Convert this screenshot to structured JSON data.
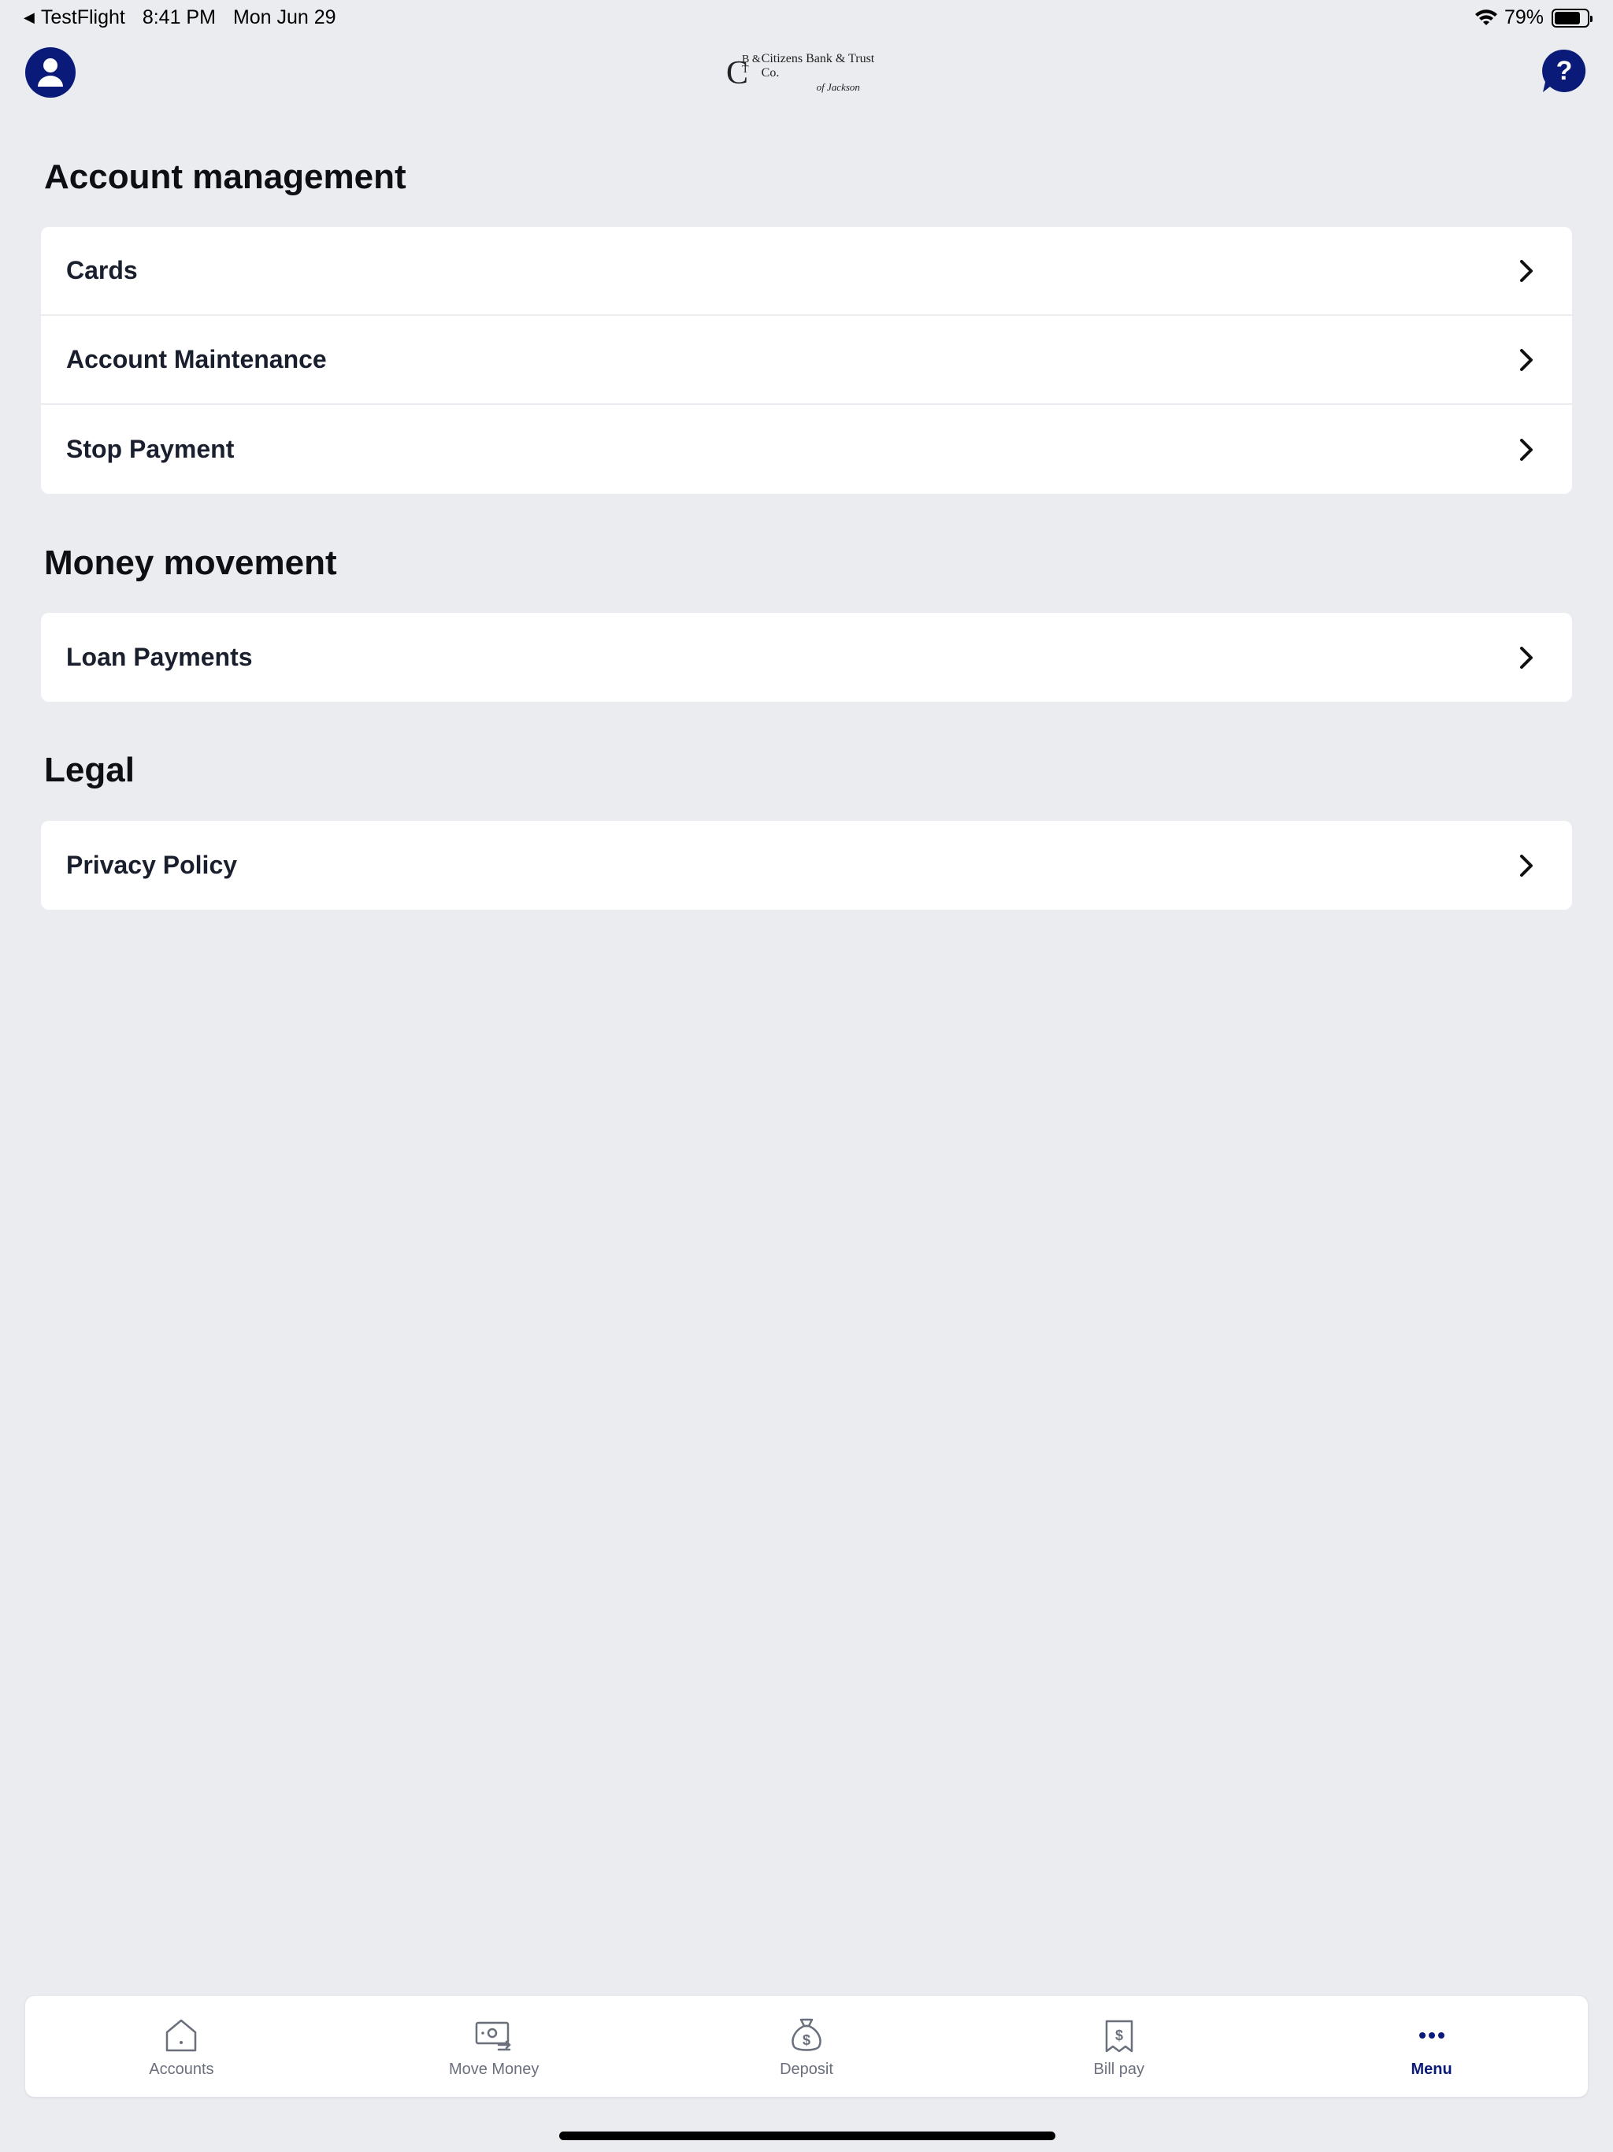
{
  "status_bar": {
    "back_app": "TestFlight",
    "time": "8:41 PM",
    "date": "Mon Jun 29",
    "battery": "79%",
    "battery_level": 0.79
  },
  "header": {
    "logo_name": "Citizens Bank & Trust Co.",
    "logo_sub": "of Jackson",
    "logo_mark_big": "C",
    "logo_mark_small": "B & T"
  },
  "sections": [
    {
      "title": "Account management",
      "items": [
        "Cards",
        "Account Maintenance",
        "Stop Payment"
      ]
    },
    {
      "title": "Money movement",
      "items": [
        "Loan Payments"
      ]
    },
    {
      "title": "Legal",
      "items": [
        "Privacy Policy"
      ]
    }
  ],
  "tab_bar": {
    "tabs": [
      {
        "label": "Accounts",
        "icon": "home-icon"
      },
      {
        "label": "Move Money",
        "icon": "money-transfer-icon"
      },
      {
        "label": "Deposit",
        "icon": "money-bag-icon"
      },
      {
        "label": "Bill pay",
        "icon": "bill-icon"
      },
      {
        "label": "Menu",
        "icon": "more-icon"
      }
    ],
    "active": "Menu"
  },
  "colors": {
    "accent": "#0a1a78",
    "background": "#ebecf0",
    "card": "#ffffff"
  }
}
